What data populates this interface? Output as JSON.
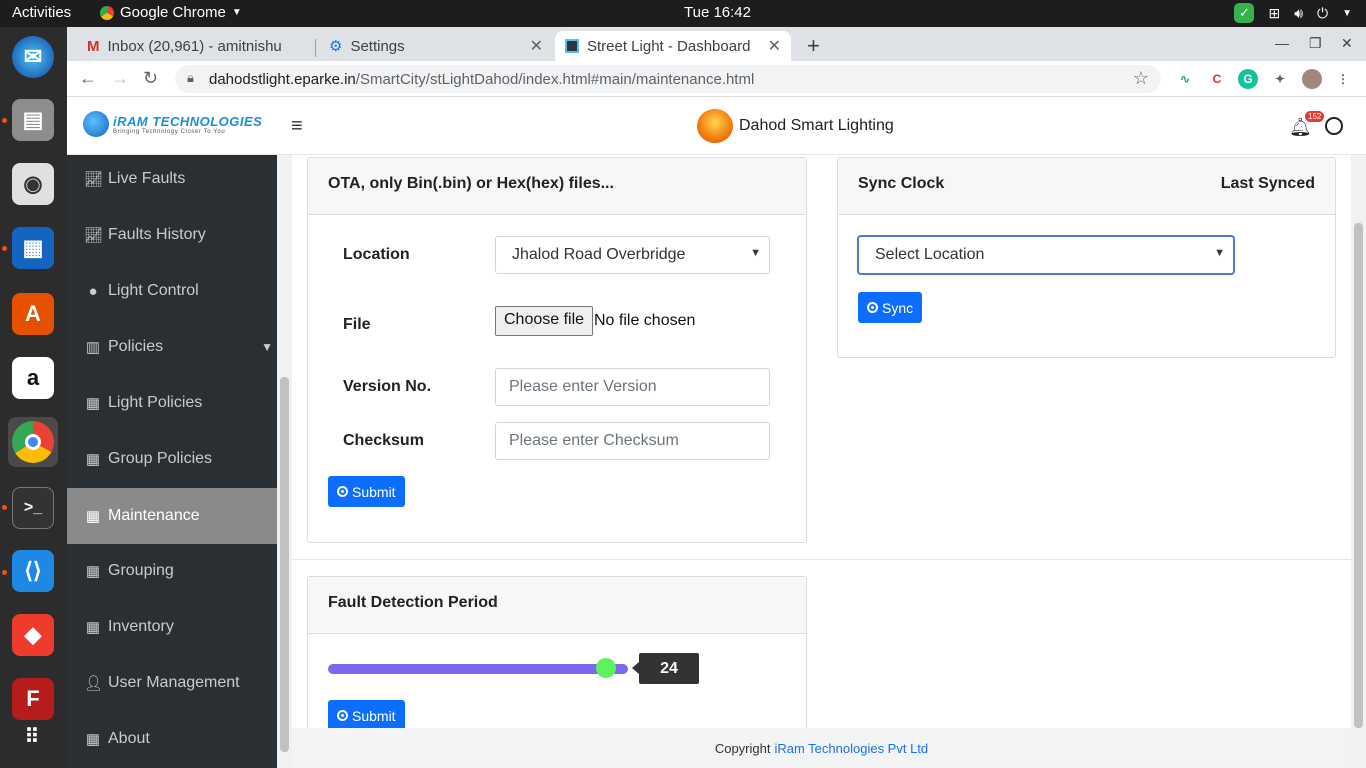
{
  "os": {
    "activities": "Activities",
    "app_name": "Google Chrome",
    "clock": "Tue 16:42"
  },
  "dock": {
    "items": [
      "thunderbird-icon",
      "files-icon",
      "rhythmbox-icon",
      "writer-icon",
      "software-icon",
      "amazon-icon",
      "chrome-icon",
      "terminal-icon",
      "vscode-icon",
      "anydesk-icon",
      "filezilla-icon",
      "apps-grid-icon"
    ]
  },
  "browser": {
    "tabs": [
      {
        "label": "Inbox (20,961) - amitnishu"
      },
      {
        "label": "Settings"
      },
      {
        "label": "Street Light - Dashboard"
      }
    ],
    "url_host": "dahodstlight.eparke.in",
    "url_path": "/SmartCity/stLightDahod/index.html#main/maintenance.html"
  },
  "header": {
    "brand": "iRAM TECHNOLOGIES",
    "tagline": "Bringing Technology Closer To You",
    "title": "Dahod Smart Lighting",
    "notification_count": "152"
  },
  "sidebar": {
    "items": [
      {
        "label": "Live Faults",
        "icon": "chart-icon"
      },
      {
        "label": "Faults History",
        "icon": "chart-icon"
      },
      {
        "label": "Light Control",
        "icon": "map-pin-icon"
      },
      {
        "label": "Policies",
        "icon": "bar-chart-icon"
      },
      {
        "label": "Light Policies",
        "icon": "table-icon"
      },
      {
        "label": "Group Policies",
        "icon": "table-icon"
      },
      {
        "label": "Maintenance",
        "icon": "table-icon"
      },
      {
        "label": "Grouping",
        "icon": "table-icon"
      },
      {
        "label": "Inventory",
        "icon": "table-icon"
      },
      {
        "label": "User Management",
        "icon": "user-icon"
      },
      {
        "label": "About",
        "icon": "table-icon"
      }
    ]
  },
  "ota": {
    "title": "OTA, only Bin(.bin) or Hex(hex) files...",
    "location_label": "Location",
    "location_value": "Jhalod Road Overbridge",
    "file_label": "File",
    "choose_file": "Choose file",
    "no_file": "No file chosen",
    "version_label": "Version No.",
    "version_placeholder": "Please enter Version",
    "checksum_label": "Checksum",
    "checksum_placeholder": "Please enter Checksum",
    "submit": "Submit"
  },
  "sync": {
    "title": "Sync Clock",
    "last_synced": "Last Synced",
    "select_placeholder": "Select Location",
    "button": "Sync"
  },
  "fault_detection": {
    "title": "Fault Detection Period",
    "value": "24",
    "submit": "Submit"
  },
  "footer": {
    "prefix": "Copyright",
    "company": "iRam Technologies Pvt Ltd"
  }
}
